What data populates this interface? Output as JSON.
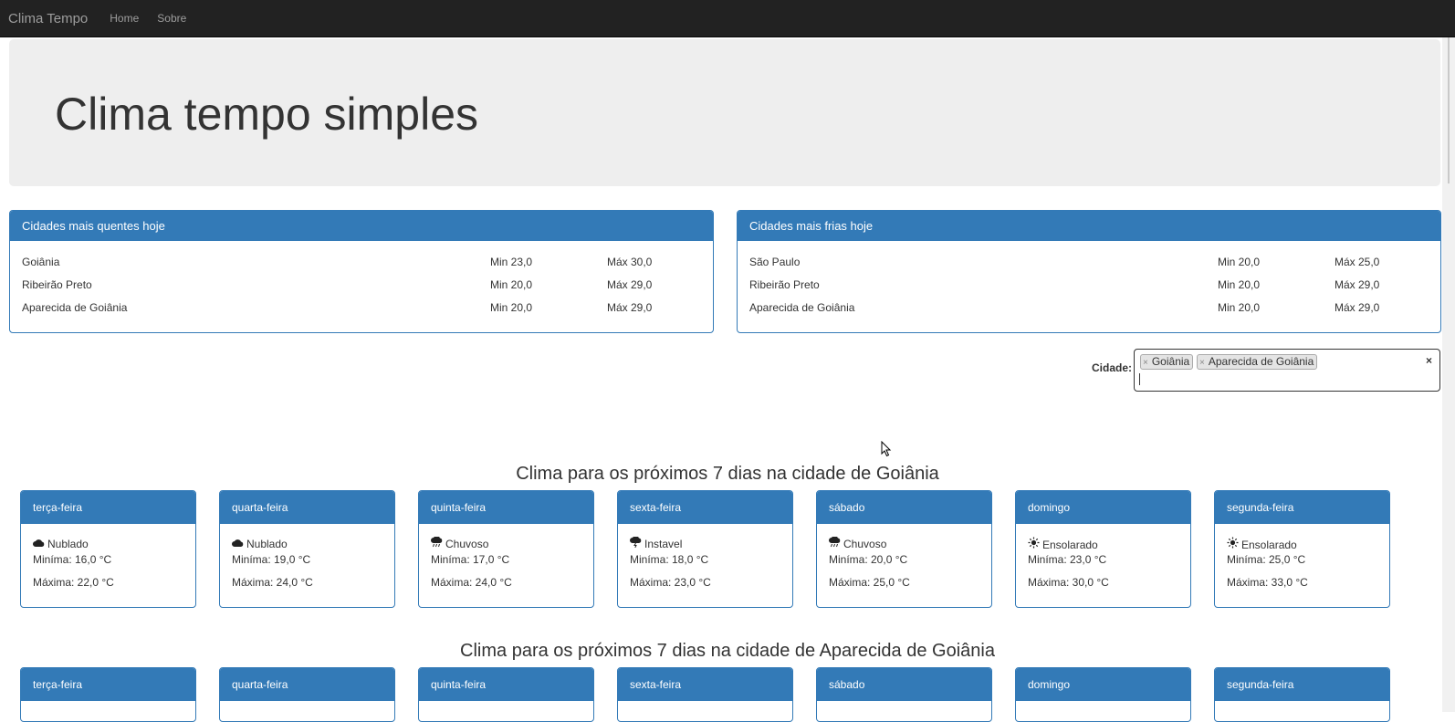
{
  "navbar": {
    "brand": "Clima Tempo",
    "links": [
      "Home",
      "Sobre"
    ]
  },
  "jumbotron": {
    "title": "Clima tempo simples"
  },
  "hottest": {
    "title": "Cidades mais quentes hoje",
    "rows": [
      {
        "city": "Goiânia",
        "min": "Min 23,0",
        "max": "Máx 30,0"
      },
      {
        "city": "Ribeirão Preto",
        "min": "Min 20,0",
        "max": "Máx 29,0"
      },
      {
        "city": "Aparecida de Goiânia",
        "min": "Min 20,0",
        "max": "Máx 29,0"
      }
    ]
  },
  "coldest": {
    "title": "Cidades mais frias hoje",
    "rows": [
      {
        "city": "São Paulo",
        "min": "Min 20,0",
        "max": "Máx 25,0"
      },
      {
        "city": "Ribeirão Preto",
        "min": "Min 20,0",
        "max": "Máx 29,0"
      },
      {
        "city": "Aparecida de Goiânia",
        "min": "Min 20,0",
        "max": "Máx 29,0"
      }
    ]
  },
  "city_select": {
    "label": "Cidade:",
    "tags": [
      "Goiânia",
      "Aparecida de Goiânia"
    ],
    "remove_glyph": "×",
    "clear_glyph": "×"
  },
  "forecasts": [
    {
      "title": "Clima para os próximos 7 dias na cidade de Goiânia",
      "days": [
        {
          "day": "terça-feira",
          "icon": "cloud-icon",
          "cond": "Nublado",
          "min": "Miníma: 16,0 °C",
          "max": "Máxima: 22,0 °C"
        },
        {
          "day": "quarta-feira",
          "icon": "cloud-icon",
          "cond": "Nublado",
          "min": "Miníma: 19,0 °C",
          "max": "Máxima: 24,0 °C"
        },
        {
          "day": "quinta-feira",
          "icon": "rain-icon",
          "cond": "Chuvoso",
          "min": "Miníma: 17,0 °C",
          "max": "Máxima: 24,0 °C"
        },
        {
          "day": "sexta-feira",
          "icon": "storm-icon",
          "cond": "Instavel",
          "min": "Miníma: 18,0 °C",
          "max": "Máxima: 23,0 °C"
        },
        {
          "day": "sábado",
          "icon": "rain-icon",
          "cond": "Chuvoso",
          "min": "Miníma: 20,0 °C",
          "max": "Máxima: 25,0 °C"
        },
        {
          "day": "domingo",
          "icon": "sun-icon",
          "cond": "Ensolarado",
          "min": "Miníma: 23,0 °C",
          "max": "Máxima: 30,0 °C"
        },
        {
          "day": "segunda-feira",
          "icon": "sun-icon",
          "cond": "Ensolarado",
          "min": "Miníma: 25,0 °C",
          "max": "Máxima: 33,0 °C"
        }
      ]
    },
    {
      "title": "Clima para os próximos 7 dias na cidade de Aparecida de Goiânia",
      "days": [
        {
          "day": "terça-feira"
        },
        {
          "day": "quarta-feira"
        },
        {
          "day": "quinta-feira"
        },
        {
          "day": "sexta-feira"
        },
        {
          "day": "sábado"
        },
        {
          "day": "domingo"
        },
        {
          "day": "segunda-feira"
        }
      ]
    }
  ],
  "colors": {
    "primary": "#337ab7",
    "navbar": "#222222",
    "jumbotron": "#eeeeee"
  }
}
